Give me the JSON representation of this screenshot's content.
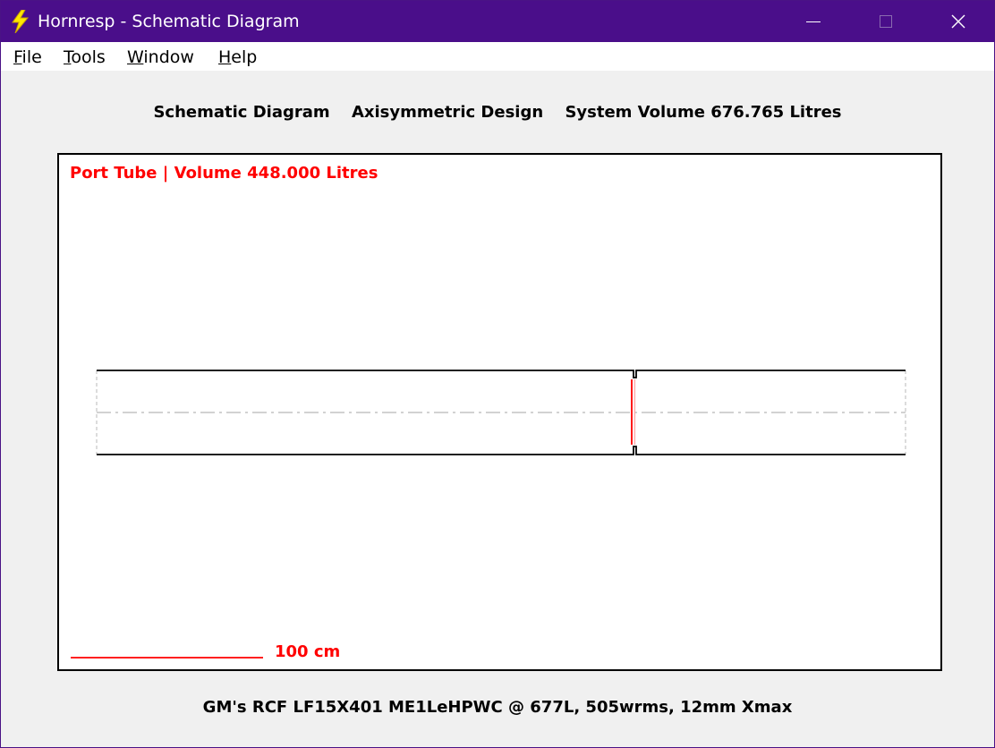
{
  "window": {
    "title": "Hornresp - Schematic Diagram",
    "icon": "lightning-bolt-icon",
    "controls": {
      "minimize": "minimize-icon",
      "maximize": "maximize-icon",
      "close": "close-icon"
    }
  },
  "menu": {
    "items": [
      {
        "label": "File",
        "mnemonic": "F",
        "rest": "ile"
      },
      {
        "label": "Tools",
        "mnemonic": "T",
        "rest": "ools"
      },
      {
        "label": "Window",
        "mnemonic": "W",
        "rest": "indow"
      },
      {
        "label": "Help",
        "mnemonic": "H",
        "rest": "elp"
      }
    ]
  },
  "header": {
    "diagram": "Schematic Diagram",
    "design": "Axisymmetric Design",
    "volume": "System Volume 676.765 Litres"
  },
  "canvas": {
    "port_label": "Port Tube | Volume 448.000 Litres",
    "scale_label": "100 cm"
  },
  "footer": {
    "description": "GM's RCF LF15X401 ME1LeHPWC @ 677L, 505wrms, 12mm Xmax"
  },
  "colors": {
    "titlebar": "#4a0e8a",
    "accent_red": "#ff0000",
    "background": "#f0f0f0"
  }
}
